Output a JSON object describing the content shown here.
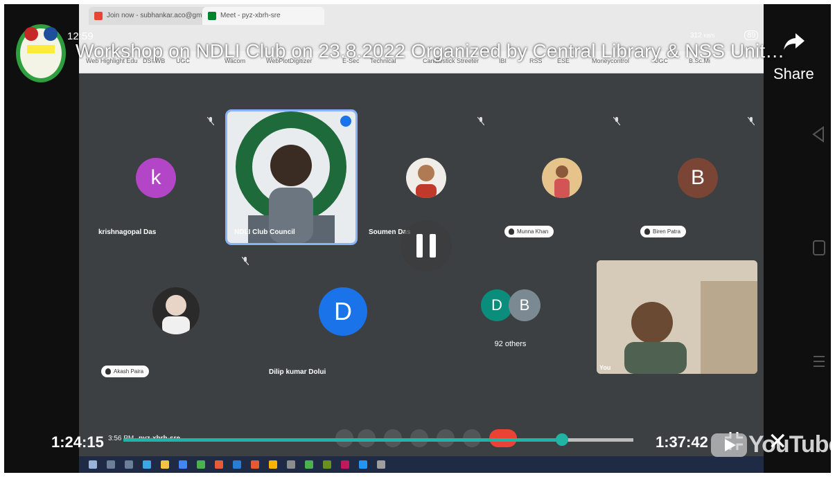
{
  "overlay": {
    "time": "12:59",
    "title": "Workshop on NDLI Club on 23.8.2022 Organized by Central Library & NSS Unit…",
    "share_label": "Share",
    "status_speed": "312",
    "status_speed_unit": "KB/S",
    "battery": "89"
  },
  "browser": {
    "tabs": [
      {
        "label": "Join now - subhankar.aco@gm..."
      },
      {
        "label": "Meet - pyz-xbrh-sre"
      }
    ],
    "bookmarks": [
      "Web Highlight Edu",
      "DS=WB",
      "UGC",
      "Wacom",
      "WebPlotDigitizer",
      "E-Sec",
      "Technical",
      "Candlestick Streeter",
      "IBI",
      "RSS",
      "ESE",
      "Moneycontrol",
      "UGC",
      "B.Sc.Mi"
    ]
  },
  "participants": [
    {
      "name": "krishnagopal Das",
      "initial": "k",
      "color": "#b246c6",
      "style": "avatar"
    },
    {
      "name": "NDLI Club Council",
      "initial": "",
      "color": "",
      "style": "video"
    },
    {
      "name": "Soumen Das",
      "initial": "",
      "color": "",
      "style": "photo"
    },
    {
      "name": "Munna Khan",
      "initial": "",
      "color": "",
      "style": "photo"
    },
    {
      "name": "Biren Patra",
      "initial": "B",
      "color": "#7b4535",
      "style": "avatar"
    },
    {
      "name": "Akash Paira",
      "initial": "",
      "color": "",
      "style": "photo"
    },
    {
      "name": "Dilip kumar Dolui",
      "initial": "D",
      "color": "#1a73e8",
      "style": "avatar"
    },
    {
      "name": "92 others",
      "initial_1": "D",
      "initial_2": "B",
      "color_1": "#0b8d7c",
      "color_2": "#7b8a92",
      "style": "group"
    },
    {
      "name": "You",
      "initial": "",
      "color": "",
      "style": "video"
    }
  ],
  "player": {
    "current_time": "1:24:15",
    "total_time": "1:37:42",
    "progress": 0.86,
    "meeting_time": "3:56 PM",
    "meeting_code": "pyz-xbrh-sre",
    "brand": "YouTube"
  },
  "colors": {
    "progress": "#1fb5a5",
    "tile_bg": "#3c4043",
    "active_outline": "#8ab4f8",
    "end_call": "#ea4335"
  }
}
